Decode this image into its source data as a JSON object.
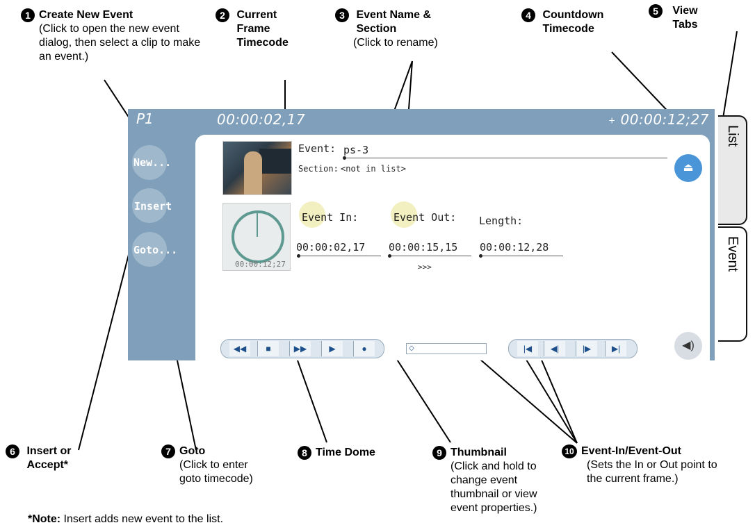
{
  "panel": {
    "player_label": "P1",
    "current_timecode": "00:00:02,17",
    "countdown_timecode": "00:00:12;27",
    "side_buttons": {
      "new": "New...",
      "insert": "Insert",
      "goto": "Goto..."
    },
    "event_label": "Event:",
    "event_name": "ps-3",
    "section_label": "Section:",
    "section_value": "<not in list>",
    "event_in_label": "Event In:",
    "event_out_label": "Event Out:",
    "length_label": "Length:",
    "event_in_value": "00:00:02,17",
    "event_out_value": "00:00:15,15",
    "length_value": "00:00:12,28",
    "time_dome_value": "00:00:12;27",
    "arrows": ">>>",
    "transport_icons": [
      "rewind-icon",
      "stop-icon",
      "fast-forward-icon",
      "play-icon",
      "record-icon"
    ],
    "jog_icons": [
      "go-to-start-icon",
      "step-back-icon",
      "step-forward-icon",
      "go-to-end-icon"
    ],
    "eject_icon": "eject-icon",
    "audio_icon": "speaker-icon",
    "slider_position": 0
  },
  "tabs": {
    "list": "List",
    "event": "Event"
  },
  "callouts": [
    {
      "n": "1",
      "title": "Create New Event",
      "desc": "(Click to open the new event dialog, then select a clip to make an event.)"
    },
    {
      "n": "2",
      "title": "Current Frame Timecode"
    },
    {
      "n": "3",
      "title": "Event Name & Section",
      "desc": "(Click to rename)"
    },
    {
      "n": "4",
      "title": "Countdown Timecode"
    },
    {
      "n": "5",
      "title": "View Tabs"
    },
    {
      "n": "6",
      "title": "Insert or Accept*"
    },
    {
      "n": "7",
      "title": "Goto",
      "desc": "(Click to enter goto timecode)"
    },
    {
      "n": "8",
      "title": "Time Dome"
    },
    {
      "n": "9",
      "title": "Thumbnail",
      "desc": "(Click and hold to change event thumbnail or view event properties.)"
    },
    {
      "n": "10",
      "title": "Event-In/Event-Out",
      "desc": "(Sets the In or Out point to the current frame.)"
    }
  ],
  "note": {
    "bold": "*Note:",
    "text": " Insert adds new event  to the list."
  },
  "colors": {
    "panel": "#7f9fba",
    "accent_blue": "#4a95d8",
    "dome_green": "#5e9a92",
    "halo": "#f2efc0"
  }
}
